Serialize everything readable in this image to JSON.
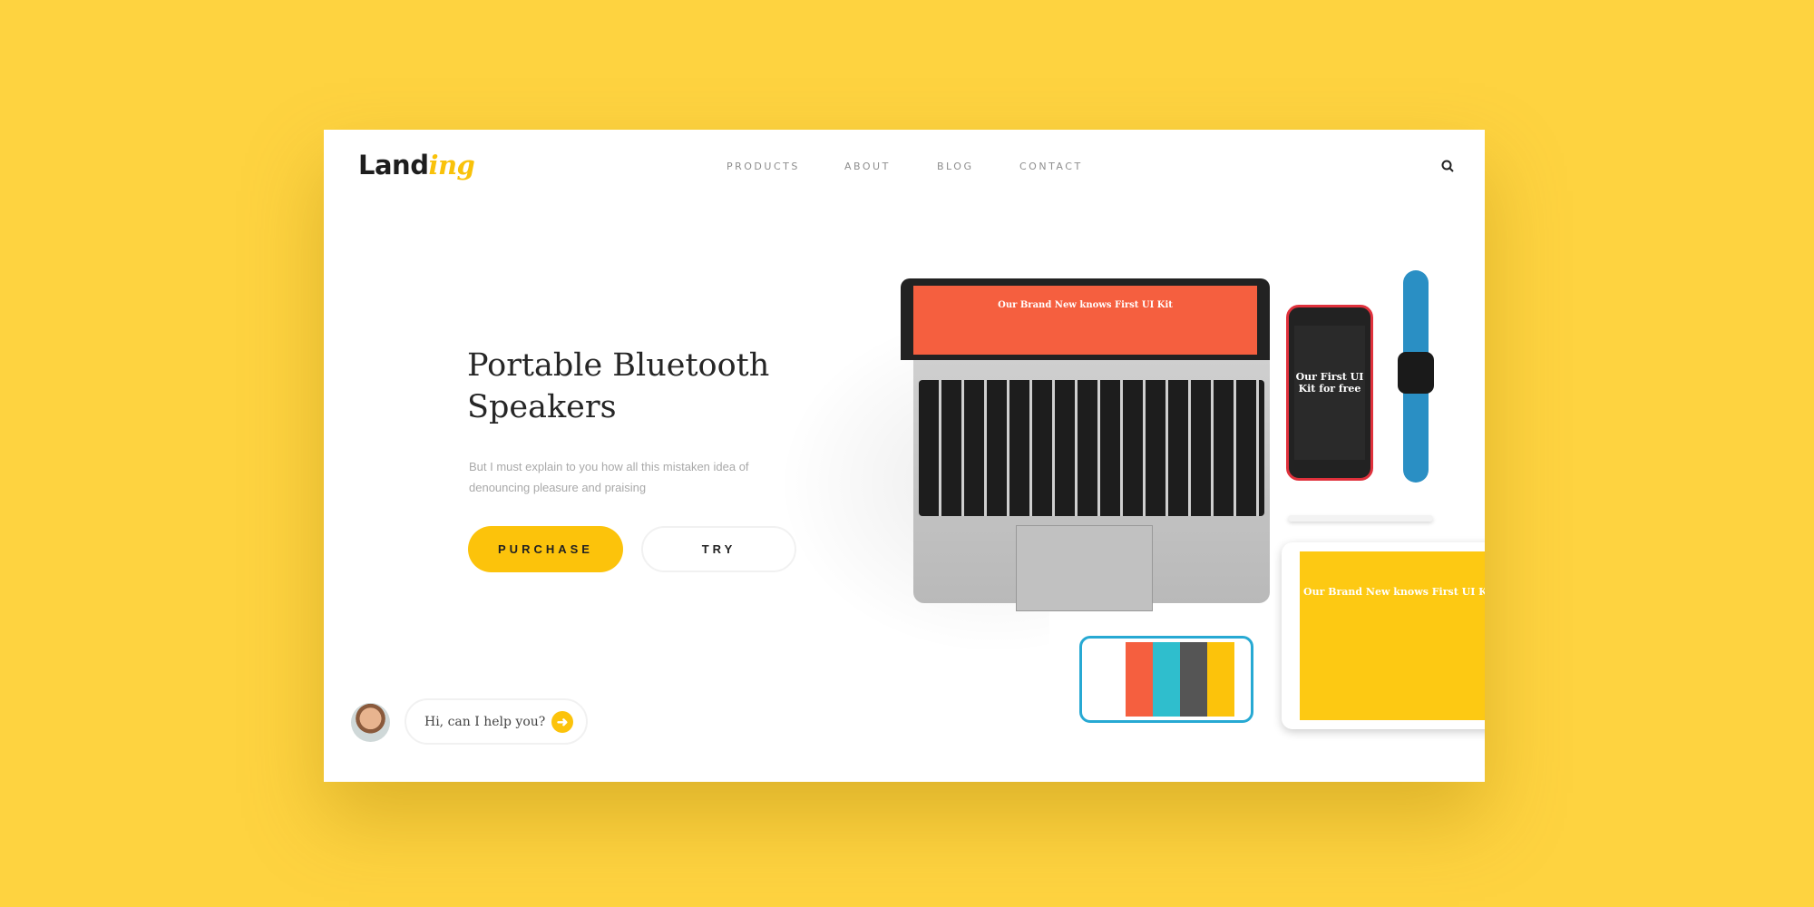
{
  "header": {
    "logo_main": "Land",
    "logo_accent": "ing",
    "nav": [
      "PRODUCTS",
      "ABOUT",
      "BLOG",
      "CONTACT"
    ],
    "search_icon": "search-icon"
  },
  "hero": {
    "title_line1": "Portable Bluetooth",
    "title_line2": "Speakers",
    "description": "But I must explain to you how all this mistaken idea of denouncing pleasure and praising",
    "purchase_label": "PURCHASE",
    "try_label": "TRY"
  },
  "chat": {
    "message": "Hi, can I help you?",
    "icon": "arrow-right-icon"
  },
  "mockups": {
    "laptop_title": "Our Brand New knows First UI Kit",
    "phone_title": "Our First UI Kit for free",
    "tablet_title": "Our Brand New knows First UI Kit"
  },
  "colors": {
    "background": "#fed340",
    "accent": "#fcc30b",
    "laptop_screen": "#f55f3f"
  }
}
